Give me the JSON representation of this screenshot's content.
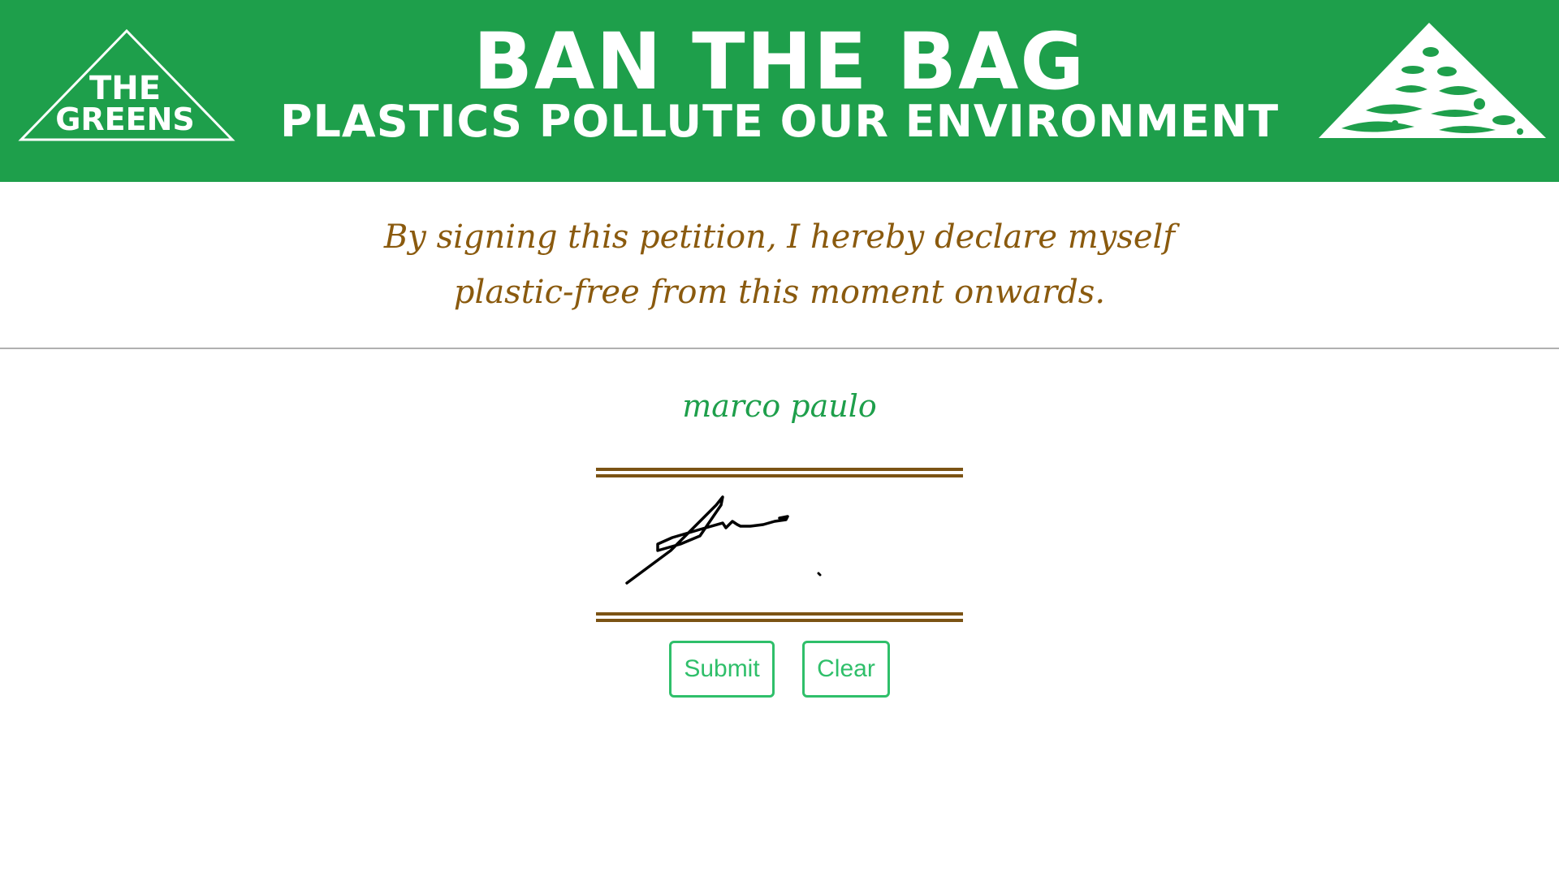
{
  "banner": {
    "logo_line1": "THE",
    "logo_line2": "GREENS",
    "title": "BAN THE BAG",
    "subtitle": "PLASTICS POLLUTE OUR ENVIRONMENT",
    "background_color": "#1e9f4b",
    "decoration_icon": "ocean-animals-triangle-icon"
  },
  "declaration": {
    "line1": "By signing this petition, I hereby declare myself",
    "line2": "plastic-free from this moment onwards.",
    "color": "#8a5a0e"
  },
  "signer": {
    "name": "marco paulo",
    "color": "#1e9f4b"
  },
  "signature_pad": {
    "border_color": "#7b5314",
    "has_signature": true
  },
  "actions": {
    "submit_label": "Submit",
    "clear_label": "Clear",
    "button_color": "#2fbf6a"
  }
}
